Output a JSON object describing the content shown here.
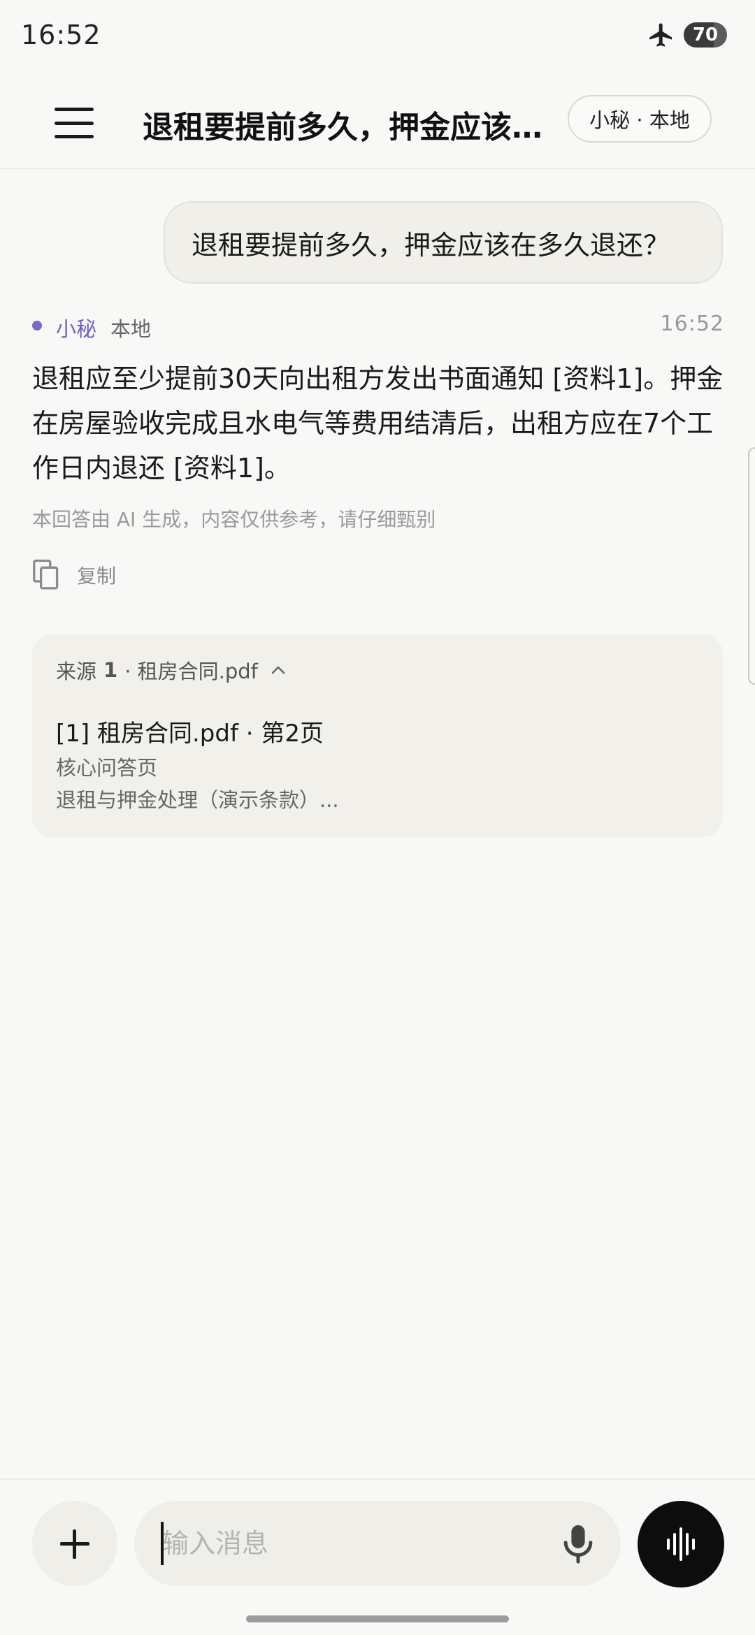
{
  "status_bar": {
    "time": "16:52",
    "battery": "70"
  },
  "header": {
    "title": "退租要提前多久，押金应该…",
    "mode_chip": "小秘 · 本地"
  },
  "conversation": {
    "user_message": "退租要提前多久，押金应该在多久退还？",
    "assistant": {
      "name": "小秘",
      "mode": "本地",
      "time": "16:52",
      "answer": "退租应至少提前30天向出租方发出书面通知 [资料1]。押金在房屋验收完成且水电气等费用结清后，出租方应在7个工作日内退还 [资料1]。",
      "disclaimer": "本回答由 AI 生成，内容仅供参考，请仔细甄别",
      "copy_label": "复制"
    },
    "sources": {
      "header_prefix": "来源",
      "count": "1",
      "header_file": "· 租房合同.pdf",
      "items": [
        {
          "title": "[1] 租房合同.pdf · 第2页",
          "subtitle": "核心问答页",
          "excerpt": "退租与押金处理（演示条款）..."
        }
      ]
    }
  },
  "composer": {
    "placeholder": "输入消息"
  },
  "icons": {
    "menu": "menu-icon",
    "airplane": "airplane-icon",
    "copy": "copy-icon",
    "chevron": "chevron-up-icon",
    "plus": "plus-icon",
    "mic": "microphone-icon",
    "voice": "voice-wave-icon"
  },
  "colors": {
    "accent": "#7b68c8",
    "background": "#f8f8f6",
    "voice_button": "#0d0d0d"
  }
}
